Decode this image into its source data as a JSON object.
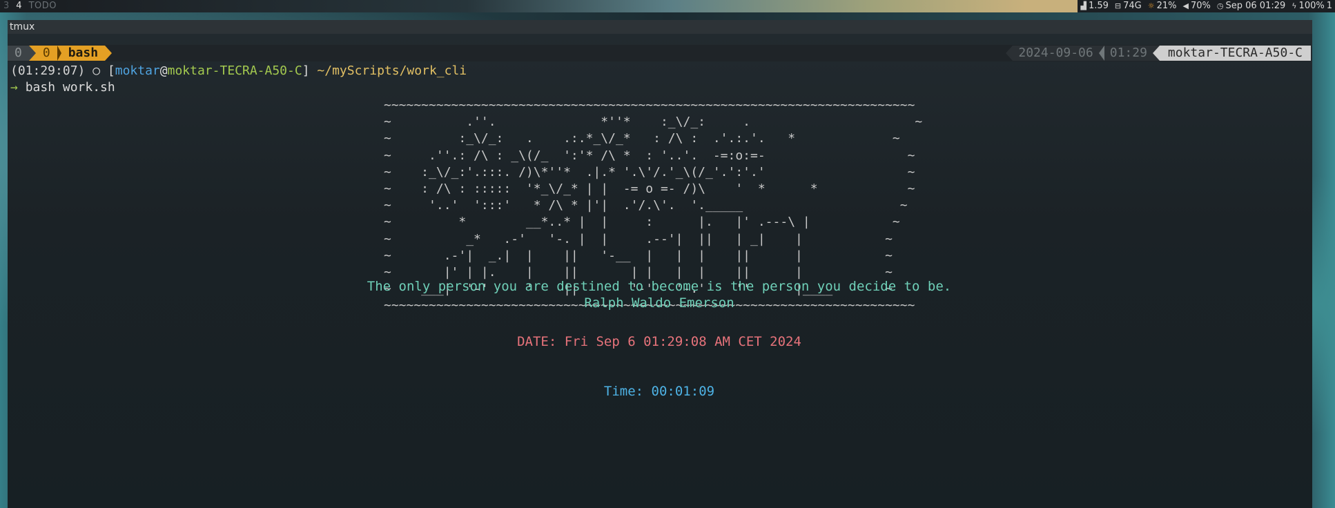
{
  "topbar": {
    "workspaces": [
      "3",
      "4",
      "TODO"
    ],
    "status": {
      "load": "1.59",
      "disk": "74G",
      "brightness": "21%",
      "volume": "70%",
      "clock": "Sep 06 01:29",
      "battery": "100%",
      "extra": "1"
    }
  },
  "window": {
    "title": "tmux"
  },
  "tmux": {
    "session": "0",
    "window_index": "0",
    "window_name": "bash",
    "date": "2024-09-06",
    "time": "01:29",
    "host": "moktar-TECRA-A50-C"
  },
  "prompt": {
    "time": "(01:29:07)",
    "symbol": "○",
    "open": "[",
    "user": "moktar",
    "at": "@",
    "host": "moktar-TECRA-A50-C",
    "close": "]",
    "path": "~/myScripts/work_cli",
    "arrow": "→",
    "command": "bash work.sh"
  },
  "ascii_art": "~~~~~~~~~~~~~~~~~~~~~~~~~~~~~~~~~~~~~~~~~~~~~~~~~~~~~~~~~~~~~~~~~~~~~~~\n~          .''.              *''*    :_\\/_:     .                      ~\n~         :_\\/_:   .    .:.*_\\/_*   : /\\ :  .'.:.'.   *             ~\n~     .''.: /\\ : _\\(/_  ':'* /\\ *  : '..'.  -=:o:=-                   ~\n~    :_\\/_:'.:::. /)\\*''*  .|.* '.\\'/.'_\\(/_'.':'.'                   ~\n~    : /\\ : :::::  '*_\\/_* | |  -= o =- /)\\    '  *      *            ~\n~     '..'  ':::'   * /\\ * |'|  .'/.\\'.  '._____                     ~\n~         *        __*..* |  |     :      |.   |' .---\\ |           ~\n~          _*   .-'   '-. |  |     .--'|  ||   | _|    |           ~\n~       .-'|  _.|  |    ||   '-__  |   |  |    ||      |           ~\n~       |' | |.    |    ||       | |   |  |    ||      |           ~\n~    ___|  '-'     '    ||       '-'   '-.'    ''      |____       ~\n~~~~~~~~~~~~~~~~~~~~~~~~~~~~~~~~~~~~~~~~~~~~~~~~~~~~~~~~~~~~~~~~~~~~~~~",
  "quote": {
    "text": "The only person you are destined to become is the person you decide to be.",
    "author": "Ralph Waldo Emerson"
  },
  "date_line": "DATE: Fri Sep  6 01:29:08 AM CET 2024",
  "time_line": "Time: 00:01:09"
}
